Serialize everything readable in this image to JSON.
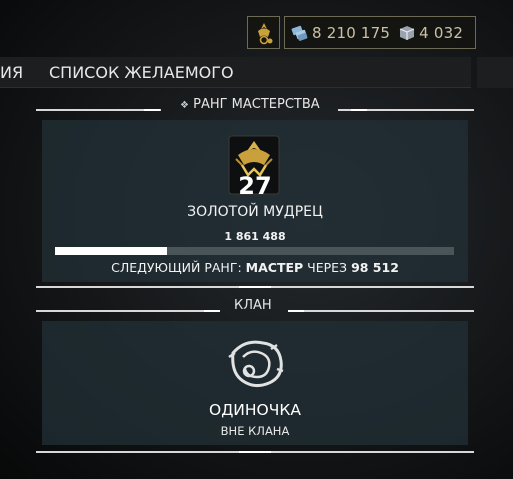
{
  "currency": {
    "credits": "8 210 175",
    "platinum": "4 032",
    "credits_icon": "credits-icon",
    "platinum_icon": "platinum-icon",
    "avatar_icon": "profile-glyph-icon"
  },
  "tabs": {
    "previous_partial": "ИЯ",
    "wishlist": "СПИСОК ЖЕЛАЕМОГО"
  },
  "mastery": {
    "section_title": "РАНГ МАСТЕРСТВА",
    "rank_number": "27",
    "rank_name": "ЗОЛОТОЙ МУДРЕЦ",
    "xp": "1 861 488",
    "progress_fraction": 0.28,
    "next_rank_prefix": "СЛЕДУЮЩИЙ РАНГ:",
    "next_rank_name": "МАСТЕР",
    "next_rank_middle": "ЧЕРЕЗ",
    "next_rank_remaining": "98 512"
  },
  "clan": {
    "section_title": "КЛАН",
    "name": "ОДИНОЧКА",
    "status": "ВНЕ КЛАНА"
  },
  "colors": {
    "accent_gold": "#c9a13a",
    "currency_border": "#6d6a55",
    "panel": "#213036"
  }
}
